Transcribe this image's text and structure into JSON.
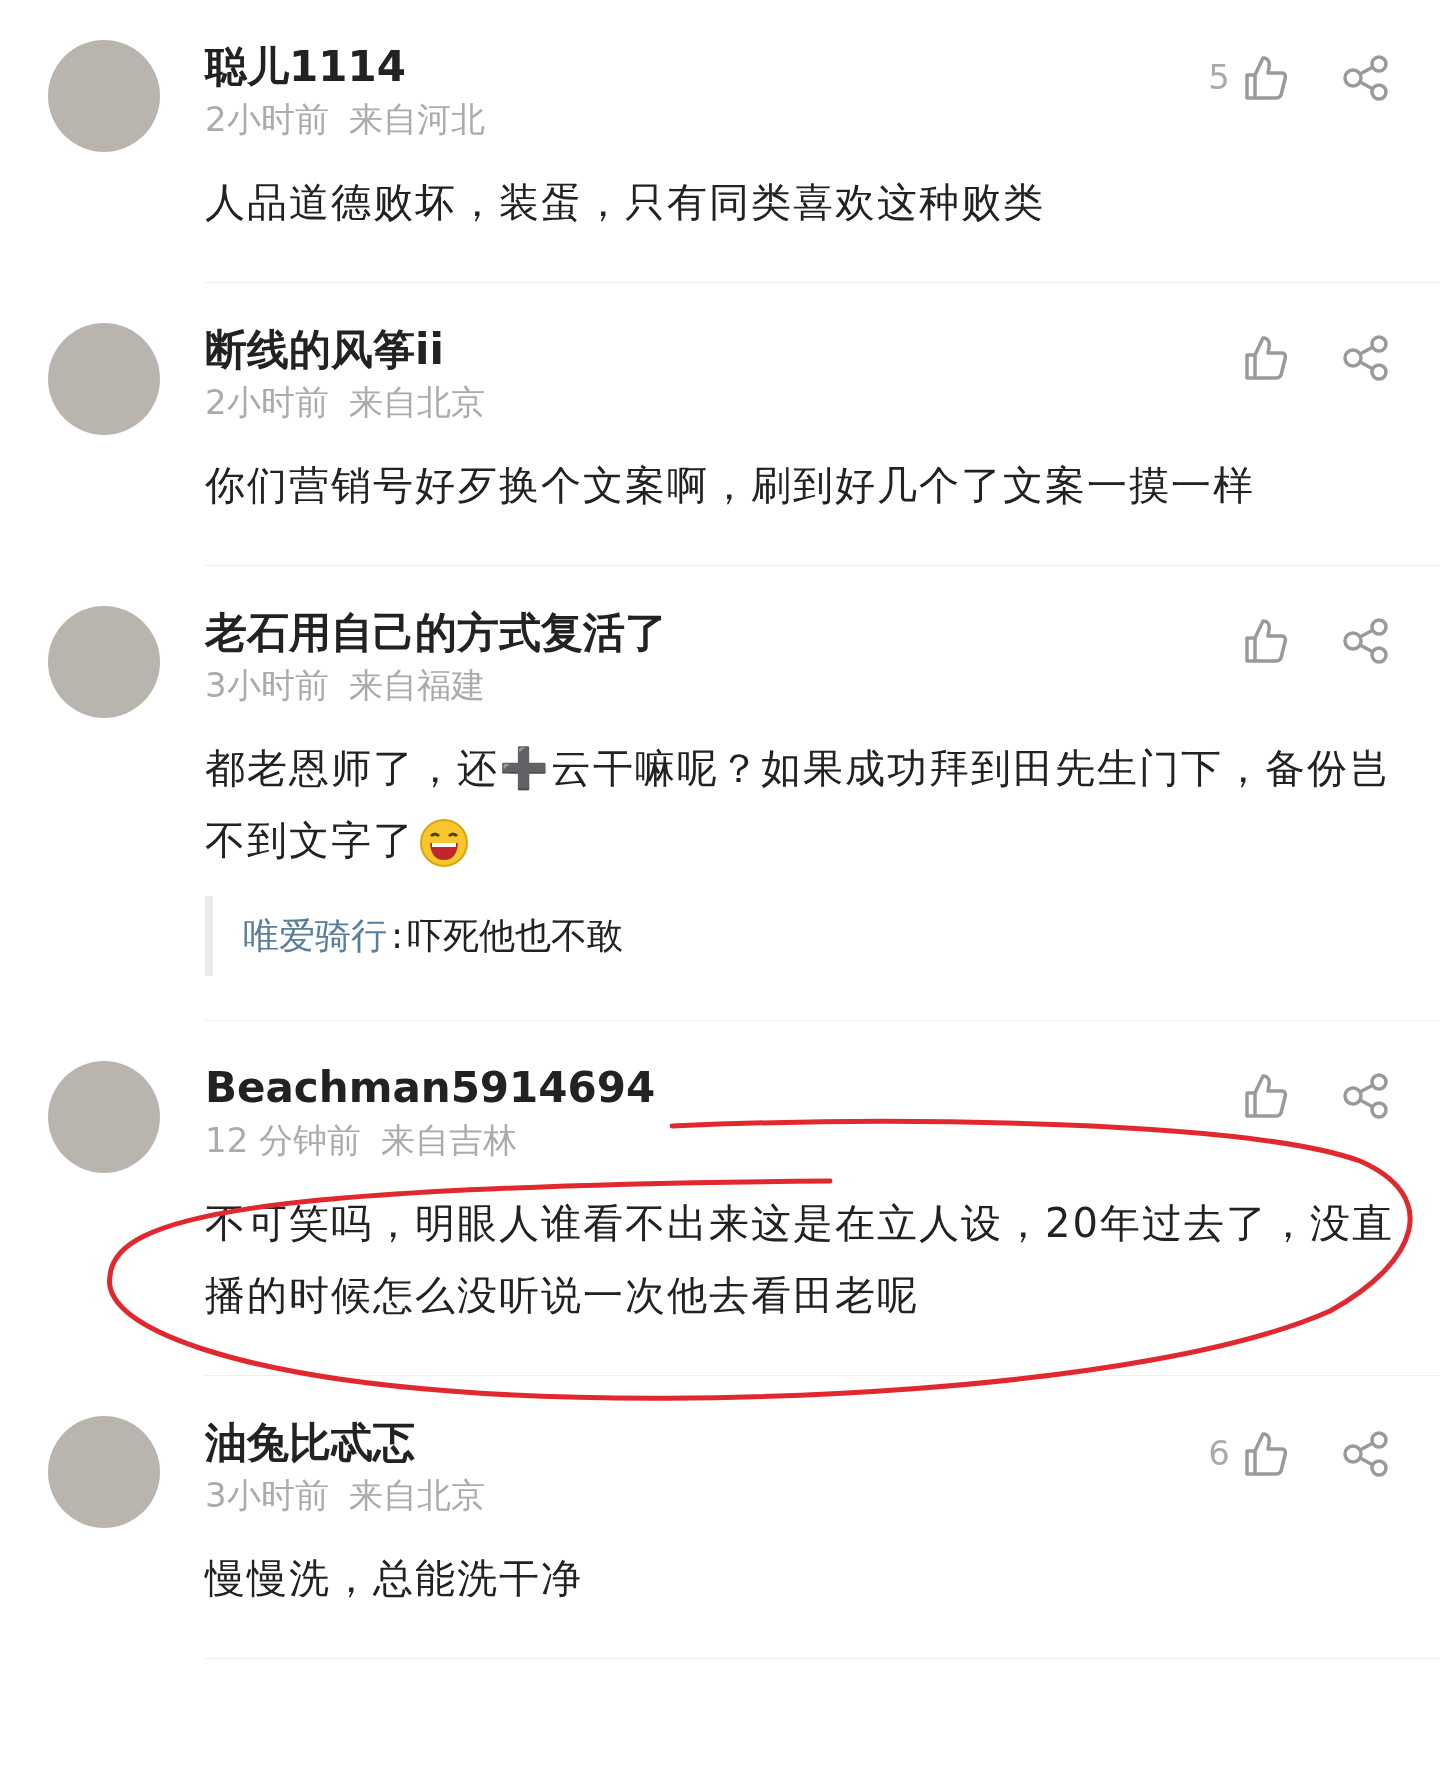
{
  "comments": [
    {
      "user": "聪儿1114",
      "time": "2小时前",
      "location": "来自河北",
      "likes": "5",
      "highlighted": false,
      "body": [
        {
          "kind": "text",
          "text": "人品道德败坏，装蛋，只有同类喜欢这种败类"
        }
      ]
    },
    {
      "user": "断线的风筝ii",
      "time": "2小时前",
      "location": "来自北京",
      "highlighted": false,
      "body": [
        {
          "kind": "text",
          "text": "你们营销号好歹换个文案啊，刷到好几个了文案一摸一样"
        }
      ]
    },
    {
      "user": "老石用自己的方式复活了",
      "time": "3小时前",
      "location": "来自福建",
      "highlighted": false,
      "body": [
        {
          "kind": "text",
          "text": "都老恩师了，还➕云干嘛呢？如果成功拜到田先生门下，备份岂不到文字了"
        },
        {
          "kind": "emoji"
        }
      ],
      "reply": {
        "user": "唯爱骑行",
        "separator": ":",
        "text": "吓死他也不敢"
      }
    },
    {
      "user": "Beachman5914694",
      "time": "12 分钟前",
      "location": "来自吉林",
      "highlighted": true,
      "body": [
        {
          "kind": "text",
          "text": "不可笑吗，明眼人谁看不出来这是在立人设，20年过去了，没直播的时候怎么没听说一次他去看田老呢"
        }
      ]
    },
    {
      "user": "油兔比忒忑",
      "time": "3小时前",
      "location": "来自北京",
      "likes": "6",
      "highlighted": false,
      "body": [
        {
          "kind": "text",
          "text": "慢慢洗，总能洗干净"
        }
      ]
    }
  ]
}
